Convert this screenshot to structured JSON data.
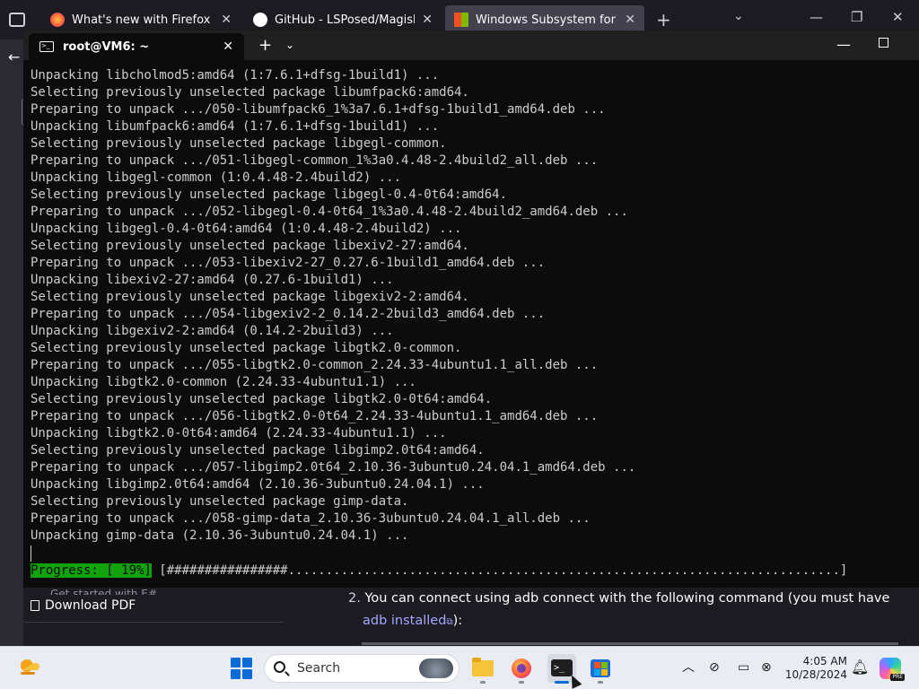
{
  "firefox": {
    "tabs": [
      {
        "title": "What's new with Firefox",
        "icon": "firefox-icon",
        "color": "#ff7139"
      },
      {
        "title": "GitHub - LSPosed/MagiskOnW",
        "icon": "github-icon",
        "color": "#ffffff"
      },
      {
        "title": "Windows Subsystem for Andro",
        "icon": "microsoft-icon",
        "color": "#00a4ef"
      }
    ],
    "page": {
      "getstarted": "Get started with E#",
      "download_pdf": "Download PDF",
      "step_num": "2.",
      "step_text": "You can connect using adb connect with the following command (you must have",
      "step_link": "adb installed",
      "step_tail": "):"
    }
  },
  "terminal": {
    "tab_title": "root@VM6: ~",
    "lines": [
      "Unpacking libcholmod5:amd64 (1:7.6.1+dfsg-1build1) ...",
      "Selecting previously unselected package libumfpack6:amd64.",
      "Preparing to unpack .../050-libumfpack6_1%3a7.6.1+dfsg-1build1_amd64.deb ...",
      "Unpacking libumfpack6:amd64 (1:7.6.1+dfsg-1build1) ...",
      "Selecting previously unselected package libgegl-common.",
      "Preparing to unpack .../051-libgegl-common_1%3a0.4.48-2.4build2_all.deb ...",
      "Unpacking libgegl-common (1:0.4.48-2.4build2) ...",
      "Selecting previously unselected package libgegl-0.4-0t64:amd64.",
      "Preparing to unpack .../052-libgegl-0.4-0t64_1%3a0.4.48-2.4build2_amd64.deb ...",
      "Unpacking libgegl-0.4-0t64:amd64 (1:0.4.48-2.4build2) ...",
      "Selecting previously unselected package libexiv2-27:amd64.",
      "Preparing to unpack .../053-libexiv2-27_0.27.6-1build1_amd64.deb ...",
      "Unpacking libexiv2-27:amd64 (0.27.6-1build1) ...",
      "Selecting previously unselected package libgexiv2-2:amd64.",
      "Preparing to unpack .../054-libgexiv2-2_0.14.2-2build3_amd64.deb ...",
      "Unpacking libgexiv2-2:amd64 (0.14.2-2build3) ...",
      "Selecting previously unselected package libgtk2.0-common.",
      "Preparing to unpack .../055-libgtk2.0-common_2.24.33-4ubuntu1.1_all.deb ...",
      "Unpacking libgtk2.0-common (2.24.33-4ubuntu1.1) ...",
      "Selecting previously unselected package libgtk2.0-0t64:amd64.",
      "Preparing to unpack .../056-libgtk2.0-0t64_2.24.33-4ubuntu1.1_amd64.deb ...",
      "Unpacking libgtk2.0-0t64:amd64 (2.24.33-4ubuntu1.1) ...",
      "Selecting previously unselected package libgimp2.0t64:amd64.",
      "Preparing to unpack .../057-libgimp2.0t64_2.10.36-3ubuntu0.24.04.1_amd64.deb ...",
      "Unpacking libgimp2.0t64:amd64 (2.10.36-3ubuntu0.24.04.1) ...",
      "Selecting previously unselected package gimp-data.",
      "Preparing to unpack .../058-gimp-data_2.10.36-3ubuntu0.24.04.1_all.deb ...",
      "Unpacking gimp-data (2.10.36-3ubuntu0.24.04.1) ..."
    ],
    "progress_label": "Progress: [ 19%]",
    "progress_bar": "[################.........................................................................]",
    "progress_percent": 19
  },
  "taskbar": {
    "search_placeholder": "Search",
    "apps": [
      {
        "name": "file-explorer"
      },
      {
        "name": "firefox"
      },
      {
        "name": "terminal",
        "active": true
      },
      {
        "name": "microsoft-store"
      }
    ],
    "time": "4:05 AM",
    "date": "10/28/2024",
    "copilot_badge": "PRE"
  },
  "colors": {
    "terminal_bg": "#0c0c0c",
    "terminal_fg": "#cccccc",
    "progress_green": "#13a10e",
    "taskbar_bg": "#e9edf3",
    "accent": "#0b6cd8"
  }
}
